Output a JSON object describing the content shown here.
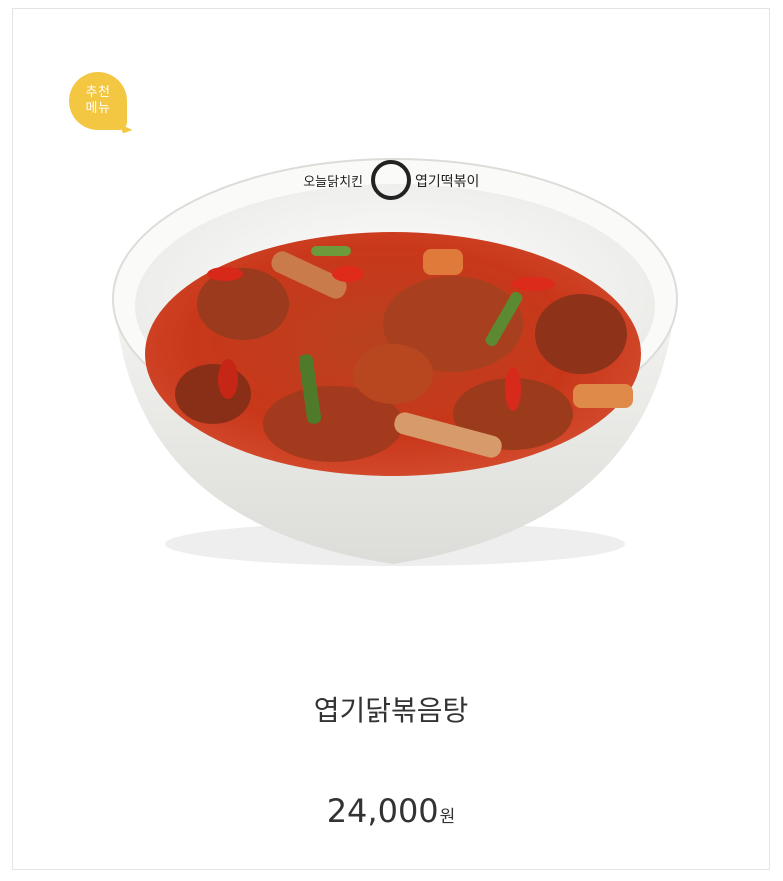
{
  "badge": {
    "line1": "추천",
    "line2": "메뉴"
  },
  "product": {
    "image_alt": "엽기닭볶음탕",
    "bowl_brand_left": "오늘닭치킨",
    "bowl_brand_right": "엽기떡볶이",
    "name": "엽기닭볶음탕",
    "price": "24,000",
    "currency": "원"
  },
  "colors": {
    "badge": "#f3c742",
    "sauce": "#c8371c",
    "bowl": "#f4f4f2"
  }
}
